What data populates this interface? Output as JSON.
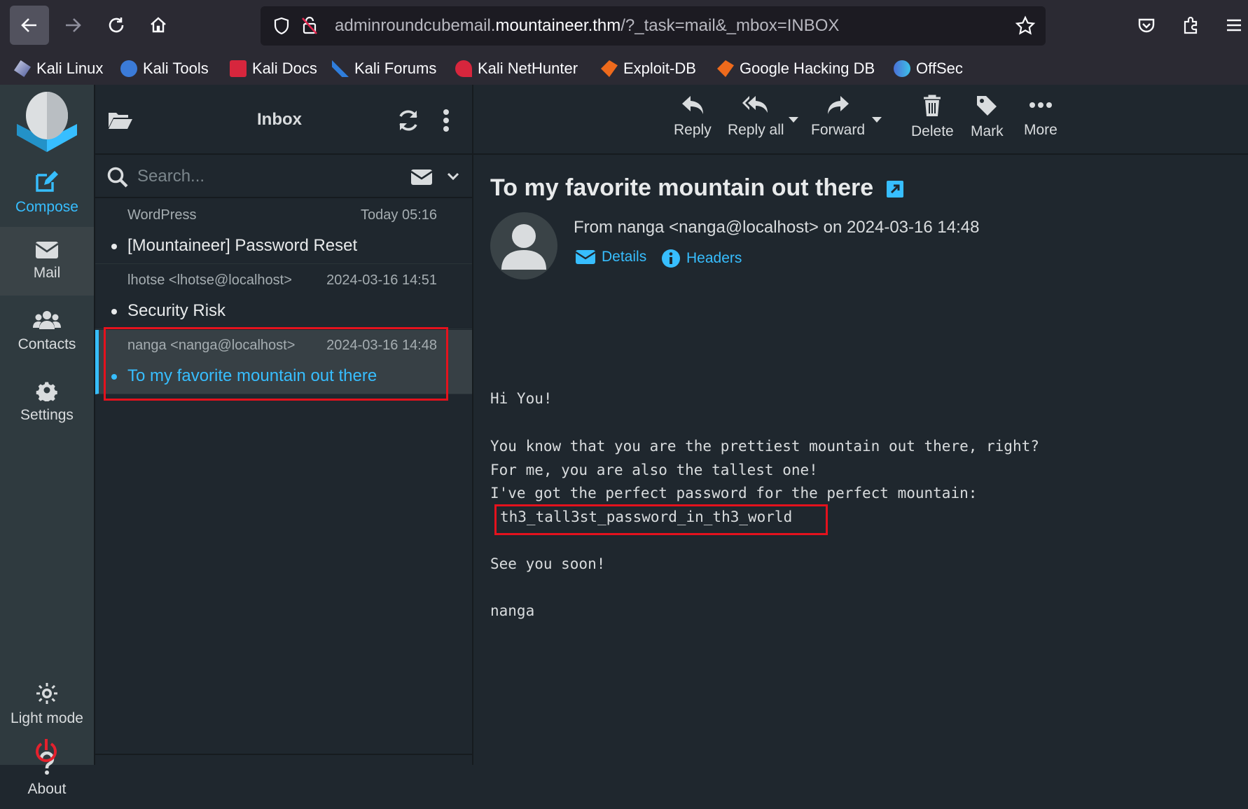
{
  "browser": {
    "url_prefix": "adminroundcubemail.",
    "url_domain": "mountaineer.thm",
    "url_suffix": "/?_task=mail&_mbox=INBOX",
    "bookmarks": [
      "Kali Linux",
      "Kali Tools",
      "Kali Docs",
      "Kali Forums",
      "Kali NetHunter",
      "Exploit-DB",
      "Google Hacking DB",
      "OffSec"
    ]
  },
  "leftnav": {
    "compose": "Compose",
    "mail": "Mail",
    "contacts": "Contacts",
    "settings": "Settings",
    "light_mode": "Light mode",
    "about": "About"
  },
  "list": {
    "title": "Inbox",
    "search_placeholder": "Search...",
    "messages": [
      {
        "from": "WordPress",
        "date": "Today 05:16",
        "subject": "[Mountaineer] Password Reset"
      },
      {
        "from": "lhotse <lhotse@localhost>",
        "date": "2024-03-16 14:51",
        "subject": "Security Risk"
      },
      {
        "from": "nanga <nanga@localhost>",
        "date": "2024-03-16 14:48",
        "subject": "To my favorite mountain out there"
      }
    ]
  },
  "toolbar": {
    "reply": "Reply",
    "reply_all": "Reply all",
    "forward": "Forward",
    "delete": "Delete",
    "mark": "Mark",
    "more": "More"
  },
  "message": {
    "subject": "To my favorite mountain out there",
    "from_line": "From nanga <nanga@localhost> on 2024-03-16 14:48",
    "details": "Details",
    "headers": "Headers",
    "greeting": "Hi You!",
    "line1": "You know that you are the prettiest mountain out there, right?",
    "line2": "For me, you are also the tallest one!",
    "line3": "I've got the perfect password for the perfect mountain:",
    "password": "th3_tall3st_password_in_th3_world",
    "closing": "See you soon!",
    "signature": "nanga"
  },
  "colors": {
    "accent": "#37beff",
    "highlight": "#e4121d",
    "background": "#1f272e"
  }
}
